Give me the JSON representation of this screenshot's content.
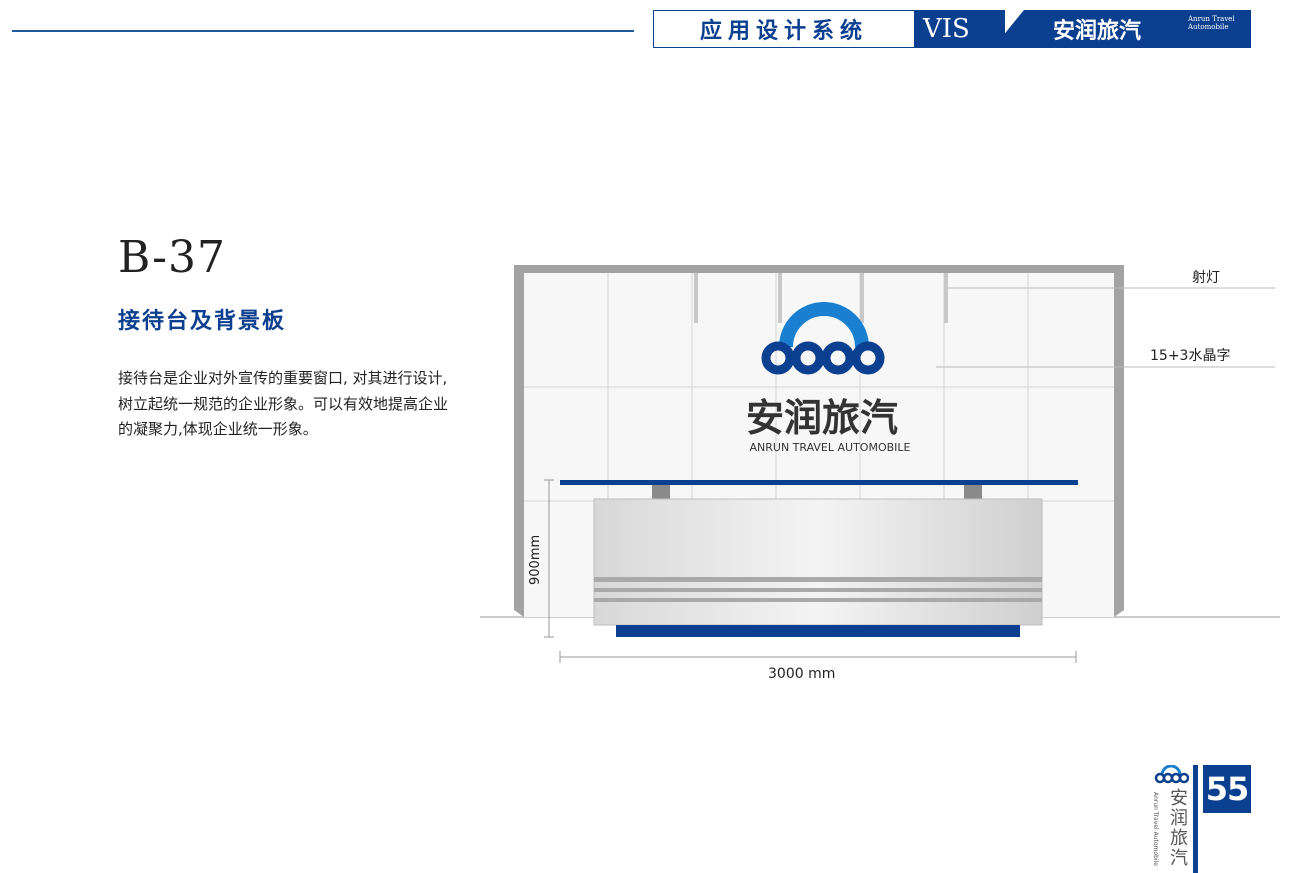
{
  "header": {
    "section": "应用设计系统",
    "tag": "VIS",
    "brand": "安润旅汽",
    "brand_en": "Anrun Travel Automobile"
  },
  "page": {
    "code": "B-37",
    "title": "接待台及背景板",
    "description": "接待台是企业对外宣传的重要窗口, 对其进行设计,树立起统一规范的企业形象。可以有效地提高企业的凝聚力,体现企业统一形象。"
  },
  "drawing": {
    "logo_cn": "安润旅汽",
    "logo_en": "ANRUN TRAVEL AUTOMOBILE",
    "label_spotlight": "射灯",
    "label_crystal": "15+3水晶字",
    "dim_height": "900mm",
    "dim_width": "3000 mm"
  },
  "footer": {
    "brand": "安润旅汽",
    "brand_en": "Anrun Travel Automobile",
    "page_number": "55"
  },
  "colors": {
    "brand_blue": "#0b3f8f",
    "wall_gray": "#9a9a9a"
  }
}
